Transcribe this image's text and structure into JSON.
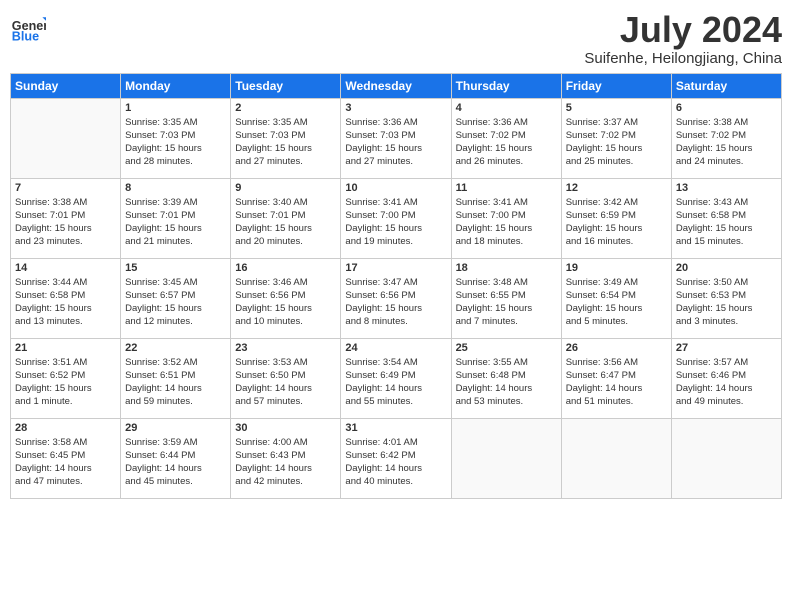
{
  "logo": {
    "general": "General",
    "blue": "Blue"
  },
  "title": "July 2024",
  "subtitle": "Suifenhe, Heilongjiang, China",
  "days": [
    "Sunday",
    "Monday",
    "Tuesday",
    "Wednesday",
    "Thursday",
    "Friday",
    "Saturday"
  ],
  "weeks": [
    [
      {
        "num": "",
        "empty": true,
        "lines": []
      },
      {
        "num": "1",
        "empty": false,
        "lines": [
          "Sunrise: 3:35 AM",
          "Sunset: 7:03 PM",
          "Daylight: 15 hours",
          "and 28 minutes."
        ]
      },
      {
        "num": "2",
        "empty": false,
        "lines": [
          "Sunrise: 3:35 AM",
          "Sunset: 7:03 PM",
          "Daylight: 15 hours",
          "and 27 minutes."
        ]
      },
      {
        "num": "3",
        "empty": false,
        "lines": [
          "Sunrise: 3:36 AM",
          "Sunset: 7:03 PM",
          "Daylight: 15 hours",
          "and 27 minutes."
        ]
      },
      {
        "num": "4",
        "empty": false,
        "lines": [
          "Sunrise: 3:36 AM",
          "Sunset: 7:02 PM",
          "Daylight: 15 hours",
          "and 26 minutes."
        ]
      },
      {
        "num": "5",
        "empty": false,
        "lines": [
          "Sunrise: 3:37 AM",
          "Sunset: 7:02 PM",
          "Daylight: 15 hours",
          "and 25 minutes."
        ]
      },
      {
        "num": "6",
        "empty": false,
        "lines": [
          "Sunrise: 3:38 AM",
          "Sunset: 7:02 PM",
          "Daylight: 15 hours",
          "and 24 minutes."
        ]
      }
    ],
    [
      {
        "num": "7",
        "empty": false,
        "lines": [
          "Sunrise: 3:38 AM",
          "Sunset: 7:01 PM",
          "Daylight: 15 hours",
          "and 23 minutes."
        ]
      },
      {
        "num": "8",
        "empty": false,
        "lines": [
          "Sunrise: 3:39 AM",
          "Sunset: 7:01 PM",
          "Daylight: 15 hours",
          "and 21 minutes."
        ]
      },
      {
        "num": "9",
        "empty": false,
        "lines": [
          "Sunrise: 3:40 AM",
          "Sunset: 7:01 PM",
          "Daylight: 15 hours",
          "and 20 minutes."
        ]
      },
      {
        "num": "10",
        "empty": false,
        "lines": [
          "Sunrise: 3:41 AM",
          "Sunset: 7:00 PM",
          "Daylight: 15 hours",
          "and 19 minutes."
        ]
      },
      {
        "num": "11",
        "empty": false,
        "lines": [
          "Sunrise: 3:41 AM",
          "Sunset: 7:00 PM",
          "Daylight: 15 hours",
          "and 18 minutes."
        ]
      },
      {
        "num": "12",
        "empty": false,
        "lines": [
          "Sunrise: 3:42 AM",
          "Sunset: 6:59 PM",
          "Daylight: 15 hours",
          "and 16 minutes."
        ]
      },
      {
        "num": "13",
        "empty": false,
        "lines": [
          "Sunrise: 3:43 AM",
          "Sunset: 6:58 PM",
          "Daylight: 15 hours",
          "and 15 minutes."
        ]
      }
    ],
    [
      {
        "num": "14",
        "empty": false,
        "lines": [
          "Sunrise: 3:44 AM",
          "Sunset: 6:58 PM",
          "Daylight: 15 hours",
          "and 13 minutes."
        ]
      },
      {
        "num": "15",
        "empty": false,
        "lines": [
          "Sunrise: 3:45 AM",
          "Sunset: 6:57 PM",
          "Daylight: 15 hours",
          "and 12 minutes."
        ]
      },
      {
        "num": "16",
        "empty": false,
        "lines": [
          "Sunrise: 3:46 AM",
          "Sunset: 6:56 PM",
          "Daylight: 15 hours",
          "and 10 minutes."
        ]
      },
      {
        "num": "17",
        "empty": false,
        "lines": [
          "Sunrise: 3:47 AM",
          "Sunset: 6:56 PM",
          "Daylight: 15 hours",
          "and 8 minutes."
        ]
      },
      {
        "num": "18",
        "empty": false,
        "lines": [
          "Sunrise: 3:48 AM",
          "Sunset: 6:55 PM",
          "Daylight: 15 hours",
          "and 7 minutes."
        ]
      },
      {
        "num": "19",
        "empty": false,
        "lines": [
          "Sunrise: 3:49 AM",
          "Sunset: 6:54 PM",
          "Daylight: 15 hours",
          "and 5 minutes."
        ]
      },
      {
        "num": "20",
        "empty": false,
        "lines": [
          "Sunrise: 3:50 AM",
          "Sunset: 6:53 PM",
          "Daylight: 15 hours",
          "and 3 minutes."
        ]
      }
    ],
    [
      {
        "num": "21",
        "empty": false,
        "lines": [
          "Sunrise: 3:51 AM",
          "Sunset: 6:52 PM",
          "Daylight: 15 hours",
          "and 1 minute."
        ]
      },
      {
        "num": "22",
        "empty": false,
        "lines": [
          "Sunrise: 3:52 AM",
          "Sunset: 6:51 PM",
          "Daylight: 14 hours",
          "and 59 minutes."
        ]
      },
      {
        "num": "23",
        "empty": false,
        "lines": [
          "Sunrise: 3:53 AM",
          "Sunset: 6:50 PM",
          "Daylight: 14 hours",
          "and 57 minutes."
        ]
      },
      {
        "num": "24",
        "empty": false,
        "lines": [
          "Sunrise: 3:54 AM",
          "Sunset: 6:49 PM",
          "Daylight: 14 hours",
          "and 55 minutes."
        ]
      },
      {
        "num": "25",
        "empty": false,
        "lines": [
          "Sunrise: 3:55 AM",
          "Sunset: 6:48 PM",
          "Daylight: 14 hours",
          "and 53 minutes."
        ]
      },
      {
        "num": "26",
        "empty": false,
        "lines": [
          "Sunrise: 3:56 AM",
          "Sunset: 6:47 PM",
          "Daylight: 14 hours",
          "and 51 minutes."
        ]
      },
      {
        "num": "27",
        "empty": false,
        "lines": [
          "Sunrise: 3:57 AM",
          "Sunset: 6:46 PM",
          "Daylight: 14 hours",
          "and 49 minutes."
        ]
      }
    ],
    [
      {
        "num": "28",
        "empty": false,
        "lines": [
          "Sunrise: 3:58 AM",
          "Sunset: 6:45 PM",
          "Daylight: 14 hours",
          "and 47 minutes."
        ]
      },
      {
        "num": "29",
        "empty": false,
        "lines": [
          "Sunrise: 3:59 AM",
          "Sunset: 6:44 PM",
          "Daylight: 14 hours",
          "and 45 minutes."
        ]
      },
      {
        "num": "30",
        "empty": false,
        "lines": [
          "Sunrise: 4:00 AM",
          "Sunset: 6:43 PM",
          "Daylight: 14 hours",
          "and 42 minutes."
        ]
      },
      {
        "num": "31",
        "empty": false,
        "lines": [
          "Sunrise: 4:01 AM",
          "Sunset: 6:42 PM",
          "Daylight: 14 hours",
          "and 40 minutes."
        ]
      },
      {
        "num": "",
        "empty": true,
        "lines": []
      },
      {
        "num": "",
        "empty": true,
        "lines": []
      },
      {
        "num": "",
        "empty": true,
        "lines": []
      }
    ]
  ]
}
